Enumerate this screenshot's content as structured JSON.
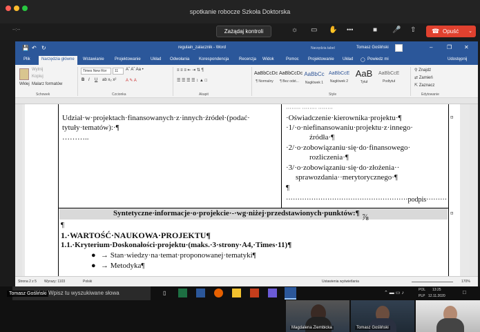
{
  "zoom": {
    "title": "spotkanie robocze Szkoła Doktorska",
    "remote_control": "Zażądaj kontroli",
    "leave": "Opuść",
    "toolbar_left": "--:--",
    "more": "•••",
    "participant_overlay": "Tomasz Gośliński"
  },
  "word": {
    "doc_title": "regulain_zalacznik - Word",
    "tools_tab": "Narzędzia tabel",
    "user": "Tomasz Gośliński",
    "tabs": [
      "Plik",
      "Narzędzia główne",
      "Wstawianie",
      "Projektowanie",
      "Układ",
      "Odwołania",
      "Korespondencja",
      "Recenzja",
      "Widok",
      "Pomoc",
      "Projektowanie",
      "Układ",
      "Powiedz mi",
      "Udostępnij"
    ],
    "ribbon": {
      "clipboard": {
        "paste": "Wklej",
        "cut": "Wytnij",
        "copy": "Kopiuj",
        "painter": "Malarz formatów",
        "label": "Schowek"
      },
      "font": {
        "name": "Times New Ror",
        "size": "11",
        "label": "Czcionka"
      },
      "paragraph": {
        "label": "Akapit"
      },
      "styles": {
        "label": "Style",
        "items": [
          {
            "sample": "AaBbCcDc",
            "name": "¶ Normalny"
          },
          {
            "sample": "AaBbCcDc",
            "name": "¶ Bez odst..."
          },
          {
            "sample": "AaBbCc",
            "name": "Nagłówek 1"
          },
          {
            "sample": "AaBbCcE",
            "name": "Nagłówek 2"
          },
          {
            "sample": "AaB",
            "name": "Tytuł"
          },
          {
            "sample": "AaBbCcE",
            "name": "Podtytuł"
          }
        ]
      },
      "editing": {
        "find": "Znajdź",
        "replace": "Zamień",
        "select": "Zaznacz",
        "label": "Edytowanie"
      }
    },
    "doc": {
      "left_cell_line1": "Udział·w·projektach·finansowanych·z·innych·źródeł·(podać·",
      "left_cell_line2": "tytuły·tematów):·¶",
      "left_cell_line3": "………..",
      "right_cell_top": "········ ········ ········",
      "right_line1": "·Oświadczenie·kierownika·projektu·¶",
      "right_line2": "·1/·o·niefinansowaniu·projektu·z·innego·",
      "right_line3": "źródła·¶",
      "right_line4": "·2/·o·zobowiązaniu·się·do·finansowego·",
      "right_line5": "rozliczenia·¶",
      "right_line6": "·3/·o·zobowiązaniu·się·do·złożenia··",
      "right_line7": "sprawozdania··merytorycznego·¶",
      "right_line8": "¶",
      "right_line9": "·····················································podpis·············································",
      "cell_end": "¤",
      "summary": "Syntetyczne·informacje·o·projekcie·-·wg·niżej·przedstawionych·punktów:¶",
      "para_mark": "¶",
      "heading1": "1.·WARTOŚĆ·NAUKOWA·PROJEKTU¶",
      "heading2": "1.1.·Kryterium·Doskonałości·projektu·(maks.·3·strony·A4,·Times·11)¶",
      "bullet1": "→ Stan·wiedzy·na·temat·proponowanej·tematyki¶",
      "bullet2": "→ Metodyka¶"
    },
    "status": {
      "page": "Strona 2 z 5",
      "words": "Wyrazy: 1103",
      "lang": "Polski",
      "display": "Ustawienia wyświetlania",
      "zoom": "170%"
    }
  },
  "taskbar": {
    "search_placeholder": "Wpisz tu wyszukiwane słowa",
    "lang1": "POL",
    "lang2": "PLP",
    "time": "13:25",
    "date": "12.11.2020"
  },
  "videos": [
    {
      "name": "Magdalena Ziembicka"
    },
    {
      "name": "Tomasz Gośliński"
    }
  ],
  "colors": {
    "word_blue": "#2b579a",
    "leave_red": "#e0412f"
  }
}
